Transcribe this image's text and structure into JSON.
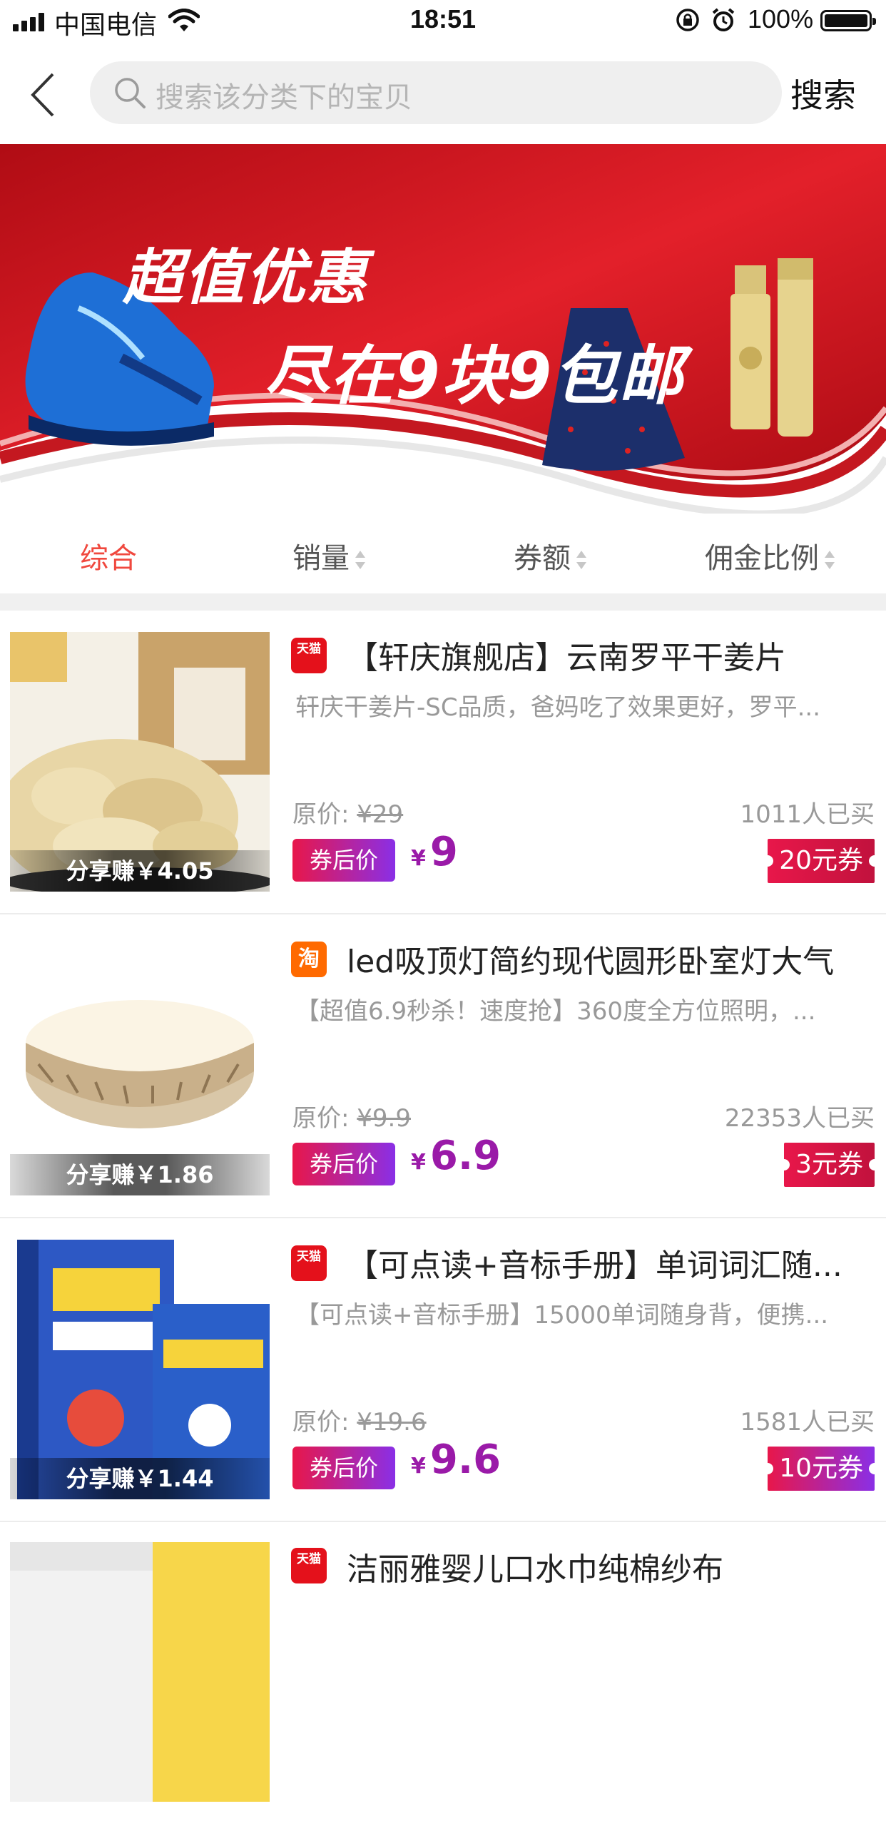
{
  "status_bar": {
    "carrier": "中国电信",
    "time": "18:51",
    "battery": "100%"
  },
  "nav": {
    "search_placeholder": "搜索该分类下的宝贝",
    "search_button": "搜索"
  },
  "banner": {
    "title_line1": "超值优惠",
    "title_line2": "尽在9块9包邮"
  },
  "sort_tabs": [
    {
      "label": "综合",
      "active": true
    },
    {
      "label": "销量",
      "active": false
    },
    {
      "label": "券额",
      "active": false
    },
    {
      "label": "佣金比例",
      "active": false
    }
  ],
  "labels": {
    "original_price_prefix": "原价:",
    "after_coupon": "券后价",
    "yen": "¥"
  },
  "products": [
    {
      "platform": "tmall",
      "platform_label": "天猫",
      "title": "【轩庆旗舰店】云南罗平干姜片",
      "desc": "轩庆干姜片-SC品质，爸妈吃了效果更好，罗平...",
      "original_price": "¥29",
      "sold": "1011人已买",
      "price": "9",
      "coupon": "20元券",
      "share": "分享赚￥4.05"
    },
    {
      "platform": "taobao",
      "platform_label": "淘",
      "title": "led吸顶灯简约现代圆形卧室灯大气",
      "desc": "【超值6.9秒杀！速度抢】360度全方位照明，...",
      "original_price": "¥9.9",
      "sold": "22353人已买",
      "price": "6.9",
      "coupon": "3元券",
      "share": "分享赚￥1.86"
    },
    {
      "platform": "tmall",
      "platform_label": "天猫",
      "title": "【可点读+音标手册】单词词汇随...",
      "desc": "【可点读+音标手册】15000单词随身背，便携...",
      "original_price": "¥19.6",
      "sold": "1581人已买",
      "price": "9.6",
      "coupon": "10元券",
      "share": "分享赚￥1.44"
    },
    {
      "platform": "tmall",
      "platform_label": "天猫",
      "title": "洁丽雅婴儿口水巾纯棉纱布"
    }
  ]
}
